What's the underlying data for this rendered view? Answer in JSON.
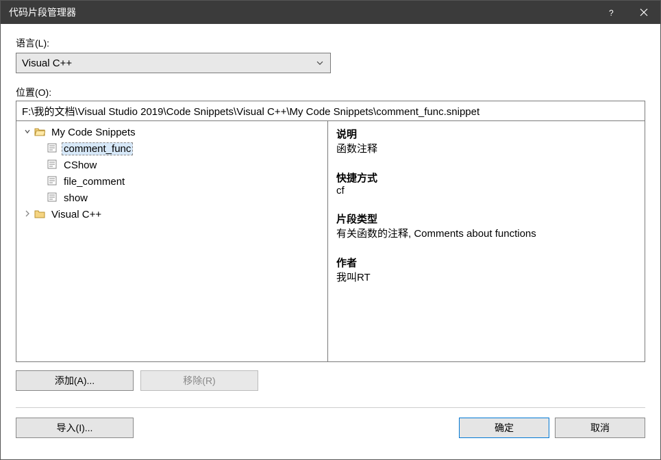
{
  "window": {
    "title": "代码片段管理器"
  },
  "labels": {
    "language": "语言(L):",
    "location": "位置(O):"
  },
  "language": {
    "selected": "Visual C++"
  },
  "location": {
    "value": "F:\\我的文档\\Visual Studio 2019\\Code Snippets\\Visual C++\\My Code Snippets\\comment_func.snippet"
  },
  "tree": {
    "root1": {
      "label": "My Code Snippets",
      "expanded": true
    },
    "items": [
      {
        "label": "comment_func",
        "selected": true
      },
      {
        "label": "CShow",
        "selected": false
      },
      {
        "label": "file_comment",
        "selected": false
      },
      {
        "label": "show",
        "selected": false
      }
    ],
    "root2": {
      "label": "Visual C++",
      "expanded": false
    }
  },
  "details": {
    "description_h": "说明",
    "description_v": "函数注释",
    "shortcut_h": "快捷方式",
    "shortcut_v": "cf",
    "type_h": "片段类型",
    "type_v": "有关函数的注释, Comments about functions",
    "author_h": "作者",
    "author_v": "我叫RT"
  },
  "buttons": {
    "add": "添加(A)...",
    "remove": "移除(R)",
    "import": "导入(I)...",
    "ok": "确定",
    "cancel": "取消"
  }
}
